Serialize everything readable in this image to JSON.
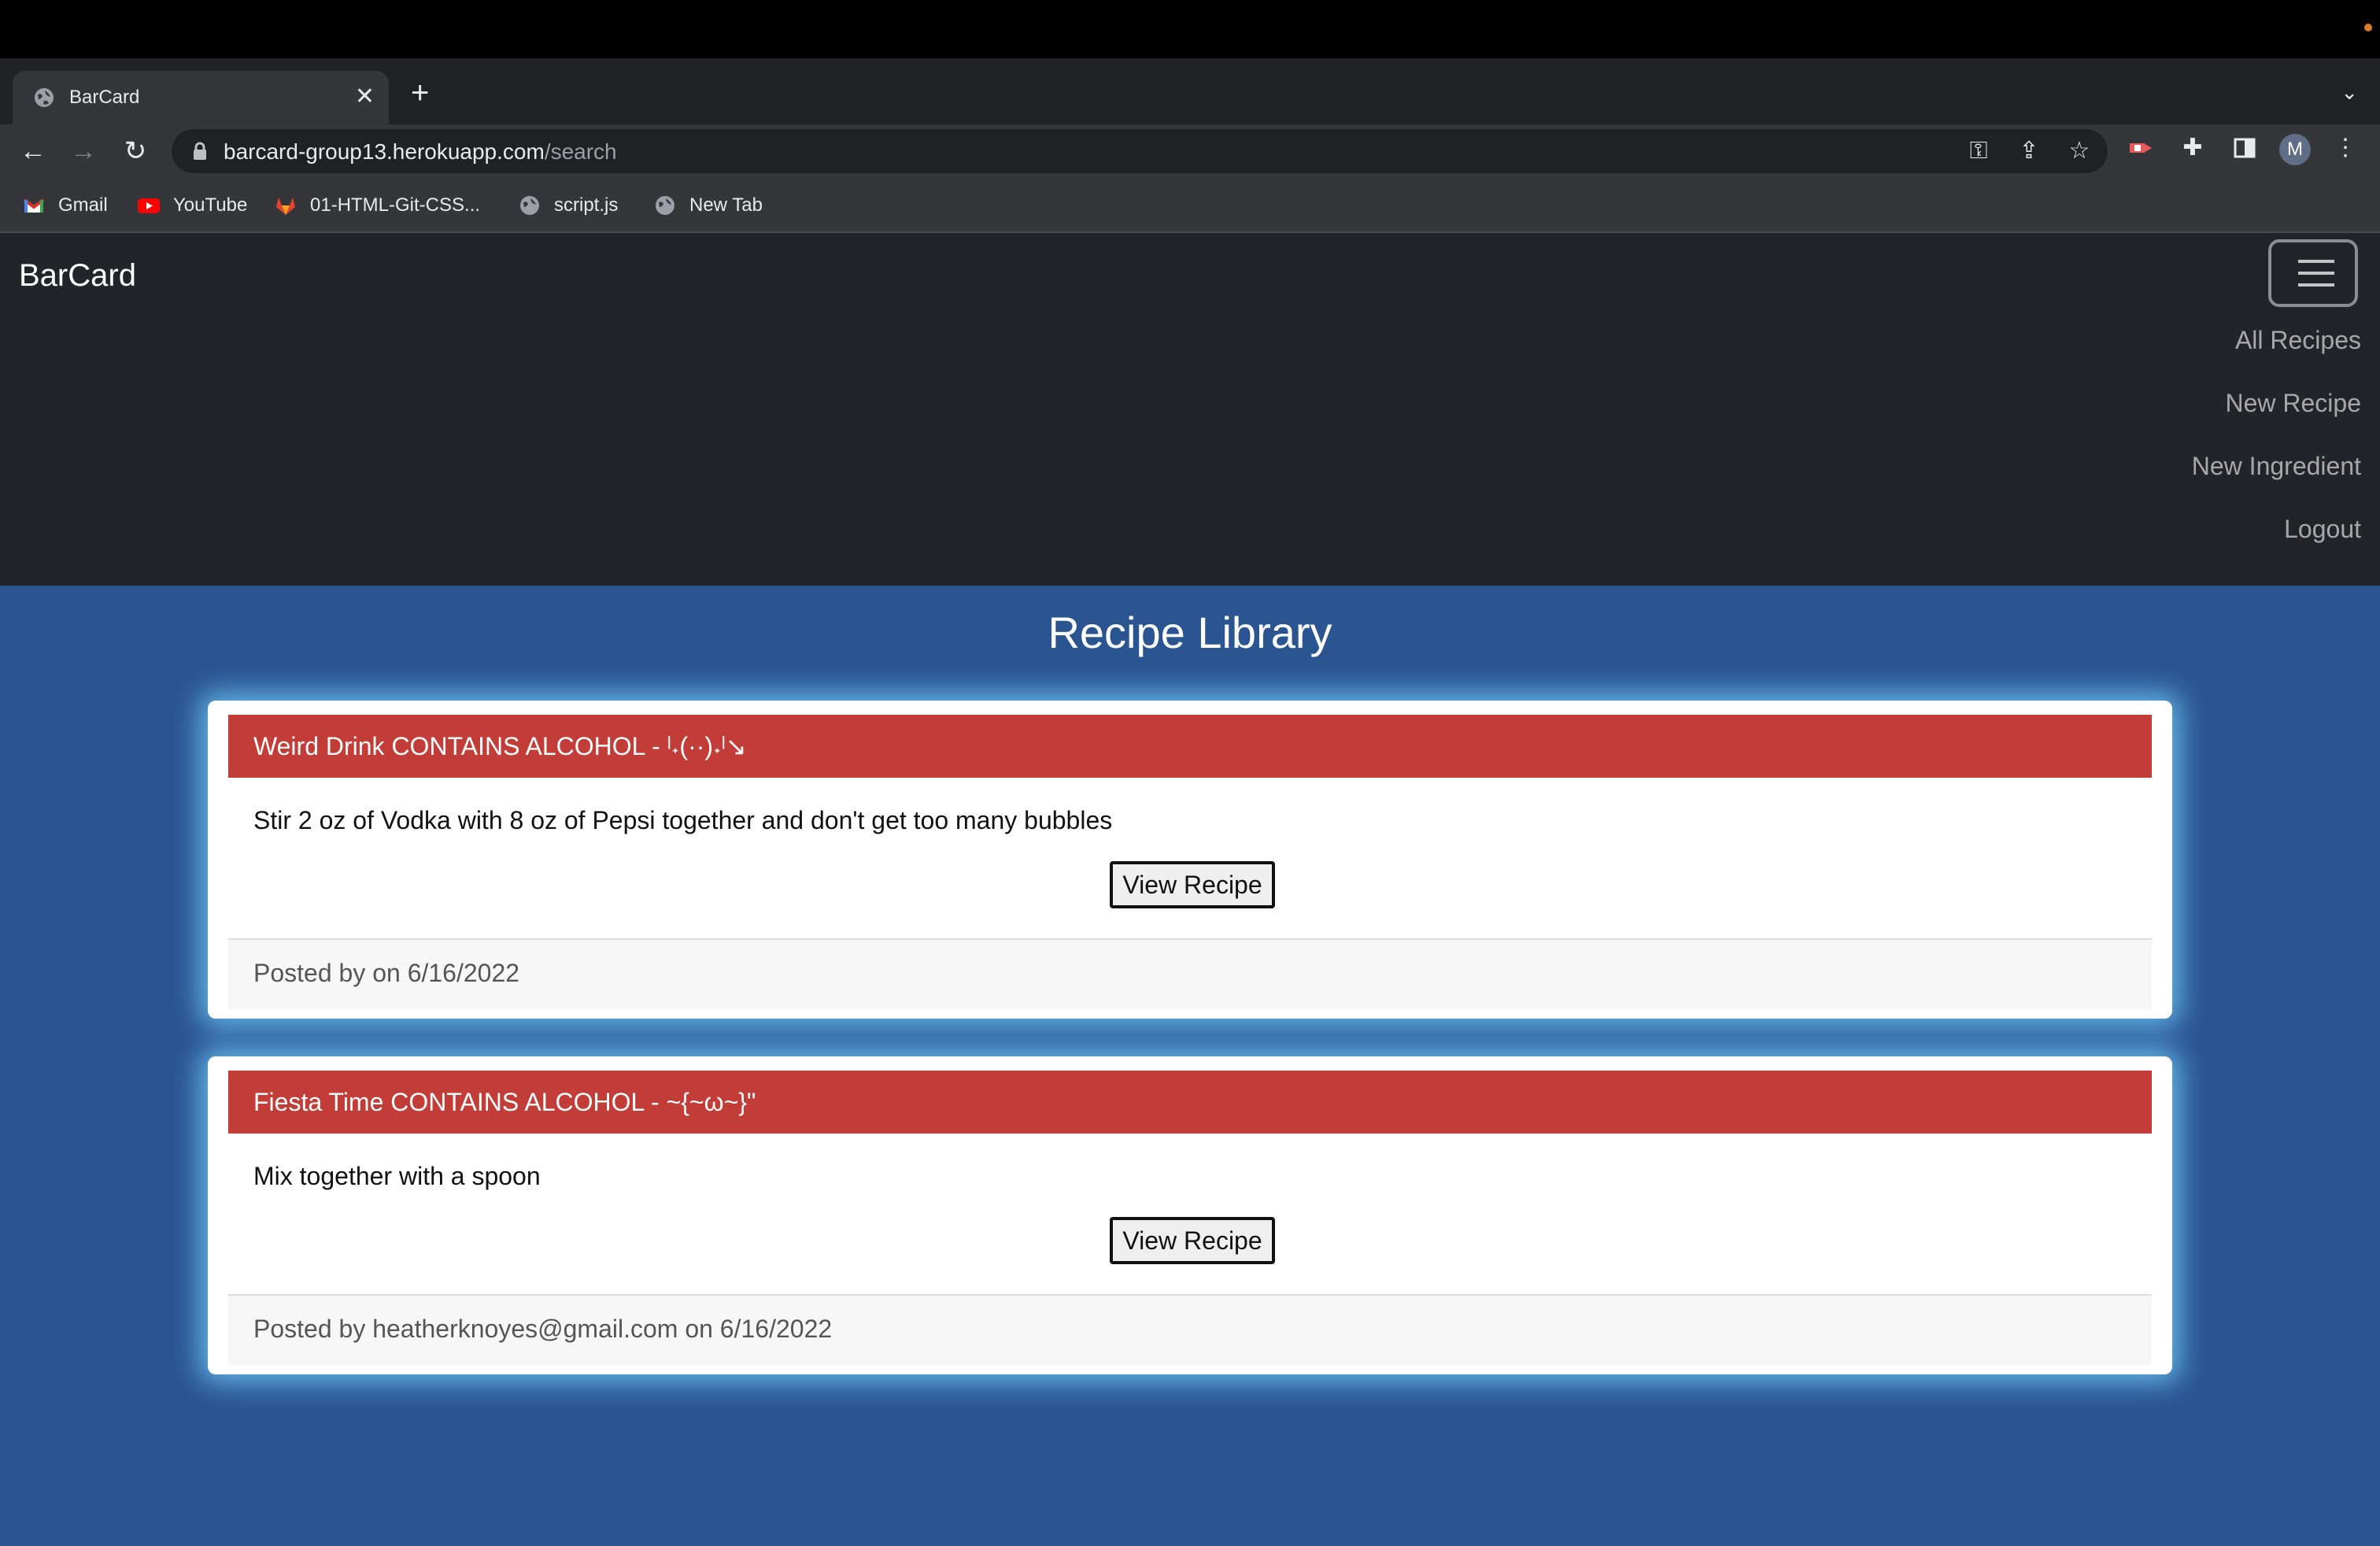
{
  "browser": {
    "tab_title": "BarCard",
    "tab_close": "✕",
    "new_tab": "+",
    "tab_search": "⌄",
    "url_host": "barcard-group13.herokuapp.com",
    "url_path": "/search",
    "bookmarks": [
      "Gmail",
      "YouTube",
      "01-HTML-Git-CSS...",
      "script.js",
      "New Tab"
    ],
    "avatar_letter": "M",
    "icons": [
      "globe-icon",
      "back-icon",
      "forward-icon",
      "reload-icon",
      "lock-icon",
      "key-icon",
      "share-icon",
      "star-icon",
      "extension-icon",
      "puzzle-icon",
      "side-panel-icon",
      "menu-kebab-icon"
    ]
  },
  "navbar": {
    "brand": "BarCard",
    "links": [
      "All Recipes",
      "New Recipe",
      "New Ingredient",
      "Logout"
    ]
  },
  "main": {
    "title": "Recipe Library",
    "recipes": [
      {
        "header": "Weird Drink CONTAINS ALCOHOL - ˡ˖(··)˖ˡ↘",
        "text": "Stir 2 oz of Vodka with 8 oz of Pepsi together and don't get too many bubbles",
        "button": "View Recipe",
        "footer": "Posted by on 6/16/2022"
      },
      {
        "header": "Fiesta Time CONTAINS ALCOHOL - ~{~ω~}\"",
        "text": "Mix together with a spoon",
        "button": "View Recipe",
        "footer": "Posted by heatherknoyes@gmail.com on 6/16/2022"
      }
    ]
  },
  "colors": {
    "page_bg": "#2b5591",
    "navbar_bg": "#212529",
    "card_header": "#c23d37",
    "card_glow": "#6ec8f5"
  }
}
